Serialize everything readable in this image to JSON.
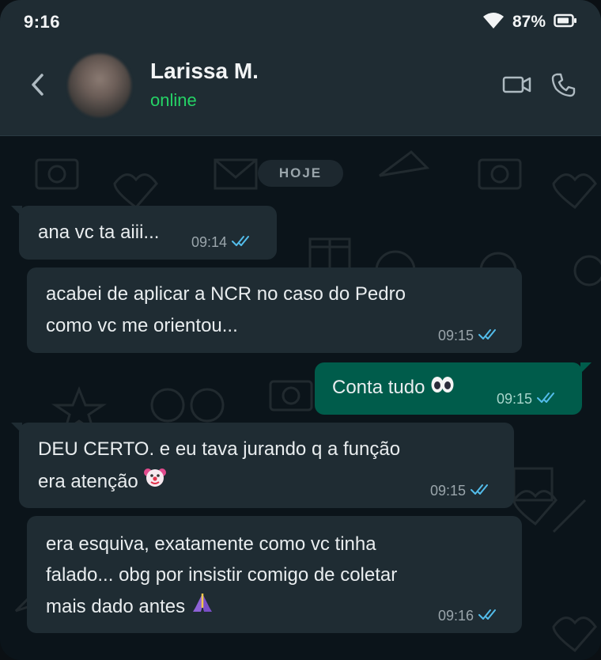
{
  "status_bar": {
    "time": "9:16",
    "battery": "87%"
  },
  "header": {
    "contact_name": "Larissa M.",
    "contact_status": "online"
  },
  "chat": {
    "day_label": "HOJE",
    "messages": [
      {
        "direction": "in",
        "text": "ana vc ta aiii...",
        "time": "09:14"
      },
      {
        "direction": "in",
        "lines": [
          "acabei de aplicar a NCR no caso do Pedro",
          "como vc me orientou..."
        ],
        "time": "09:15"
      },
      {
        "direction": "out",
        "text": "Conta tudo",
        "emoji": "eyes",
        "time": "09:15"
      },
      {
        "direction": "in",
        "lines": [
          "DEU CERTO. e eu tava jurando q a função",
          "era atenção"
        ],
        "emoji": "clown-face",
        "time": "09:15"
      },
      {
        "direction": "in",
        "lines": [
          "era esquiva, exatamente como vc tinha",
          "falado... obg por insistir comigo de coletar",
          "mais dado antes"
        ],
        "emoji": "folded-hands",
        "time": "09:16"
      }
    ]
  },
  "colors": {
    "header_bg": "#1f2c33",
    "chat_bg": "#0b141a",
    "incoming_bubble": "#1f2c33",
    "outgoing_bubble": "#005c4b",
    "online_green": "#25d366",
    "read_tick_blue": "#53bdeb"
  },
  "icons": [
    "wifi-icon",
    "battery-icon",
    "back-arrow-icon",
    "video-call-icon",
    "phone-icon",
    "read-receipt-icon"
  ]
}
